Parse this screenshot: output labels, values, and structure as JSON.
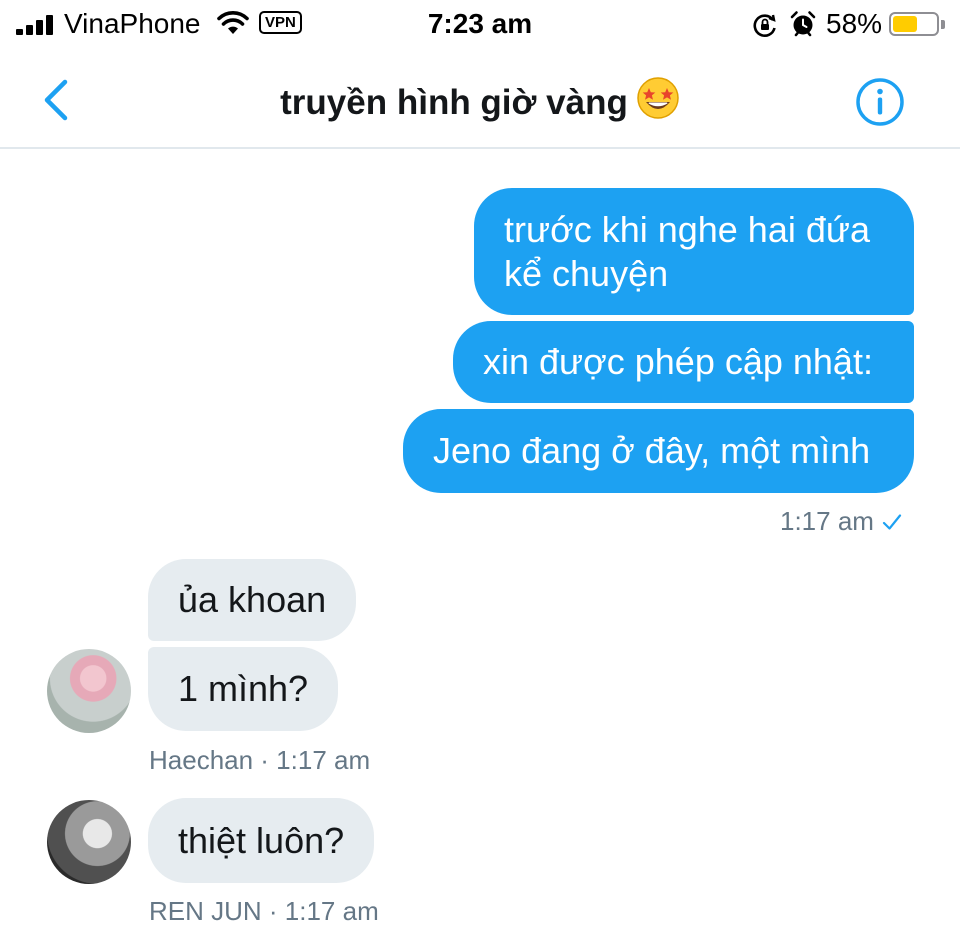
{
  "status_bar": {
    "carrier": "VinaPhone",
    "vpn": "VPN",
    "time": "7:23 am",
    "battery_percent": "58%",
    "battery_level": 0.58,
    "battery_color": "#ffcc00",
    "icons": [
      "signal-icon",
      "wifi-icon",
      "rotation-lock-icon",
      "alarm-icon",
      "battery-icon"
    ]
  },
  "header": {
    "title": "truyền hình giờ vàng",
    "title_emoji": "star-struck-emoji",
    "back_icon": "chevron-left-icon",
    "info_icon": "info-icon"
  },
  "messages": {
    "outgoing": [
      "trước khi nghe hai đứa kể chuyện",
      "xin được phép cập nhật:",
      "Jeno đang ở đây, một mình"
    ],
    "outgoing_meta": "1:17 am",
    "haechan": {
      "bubbles": [
        "ủa khoan",
        "1 mình?"
      ],
      "meta": "Haechan · 1:17 am"
    },
    "renjun": {
      "bubbles": [
        "thiệt luôn?"
      ],
      "meta": "REN JUN · 1:17 am"
    }
  },
  "colors": {
    "accent": "#1da1f2",
    "incoming_bubble": "#e6ecf0",
    "meta_text": "#657786"
  }
}
